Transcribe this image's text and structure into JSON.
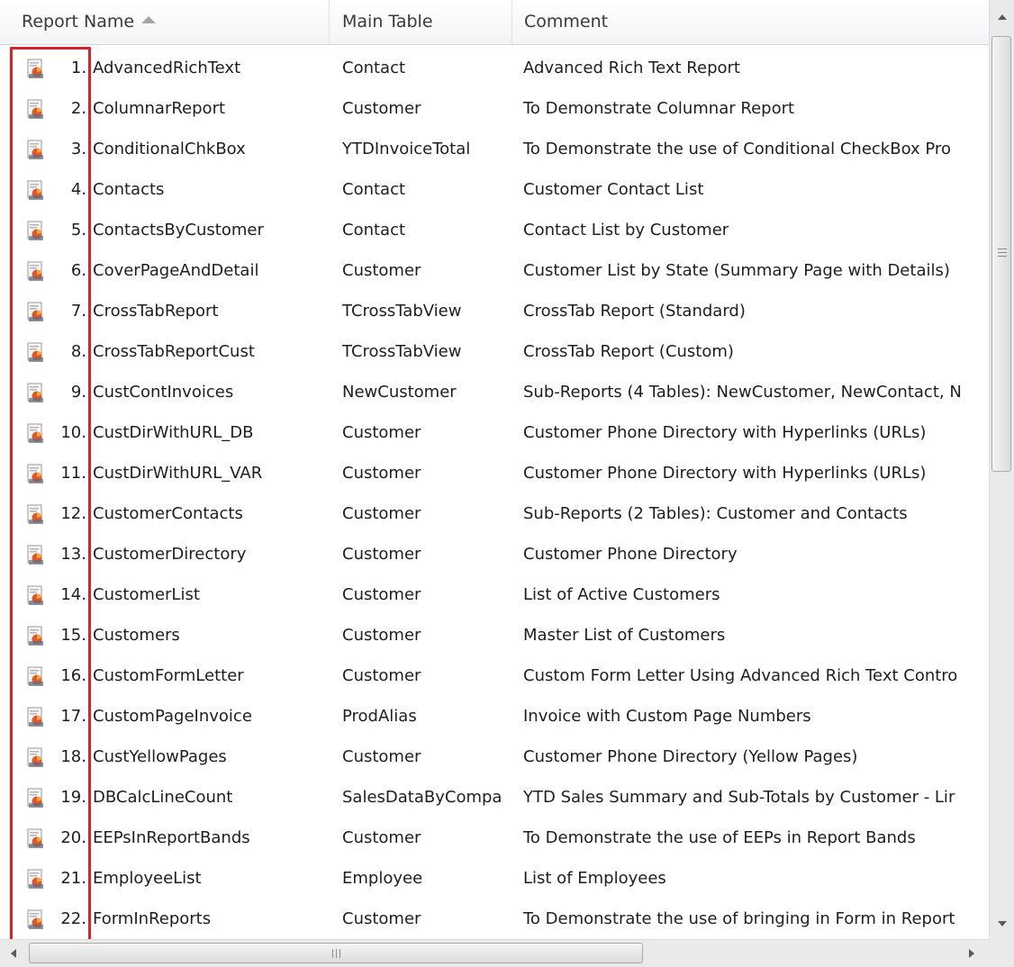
{
  "columns": {
    "name": "Report Name",
    "table": "Main Table",
    "comment": "Comment"
  },
  "sort": {
    "column": "Report Name",
    "direction": "ascending"
  },
  "highlight_color": "#d8232a",
  "rows": [
    {
      "num": "1.",
      "name": "AdvancedRichText",
      "table": "Contact",
      "comment": "Advanced Rich Text Report"
    },
    {
      "num": "2.",
      "name": "ColumnarReport",
      "table": "Customer",
      "comment": "To Demonstrate Columnar Report"
    },
    {
      "num": "3.",
      "name": "ConditionalChkBox",
      "table": "YTDInvoiceTotal",
      "comment": "To Demonstrate the use of Conditional CheckBox Pro"
    },
    {
      "num": "4.",
      "name": "Contacts",
      "table": "Contact",
      "comment": "Customer Contact List"
    },
    {
      "num": "5.",
      "name": "ContactsByCustomer",
      "table": "Contact",
      "comment": "Contact List by Customer"
    },
    {
      "num": "6.",
      "name": "CoverPageAndDetail",
      "table": "Customer",
      "comment": "Customer List by State (Summary Page with Details)"
    },
    {
      "num": "7.",
      "name": "CrossTabReport",
      "table": "TCrossTabView",
      "comment": "CrossTab Report (Standard)"
    },
    {
      "num": "8.",
      "name": "CrossTabReportCust",
      "table": "TCrossTabView",
      "comment": "CrossTab Report (Custom)"
    },
    {
      "num": "9.",
      "name": "CustContInvoices",
      "table": "NewCustomer",
      "comment": "Sub-Reports (4 Tables): NewCustomer, NewContact, N"
    },
    {
      "num": "10.",
      "name": "CustDirWithURL_DB",
      "table": "Customer",
      "comment": "Customer Phone Directory with Hyperlinks (URLs)"
    },
    {
      "num": "11.",
      "name": "CustDirWithURL_VAR",
      "table": "Customer",
      "comment": "Customer Phone Directory with Hyperlinks (URLs)"
    },
    {
      "num": "12.",
      "name": "CustomerContacts",
      "table": "Customer",
      "comment": "Sub-Reports (2 Tables): Customer and Contacts"
    },
    {
      "num": "13.",
      "name": "CustomerDirectory",
      "table": "Customer",
      "comment": "Customer Phone Directory"
    },
    {
      "num": "14.",
      "name": "CustomerList",
      "table": "Customer",
      "comment": "List of Active Customers"
    },
    {
      "num": "15.",
      "name": "Customers",
      "table": "Customer",
      "comment": "Master List of Customers"
    },
    {
      "num": "16.",
      "name": "CustomFormLetter",
      "table": "Customer",
      "comment": "Custom Form Letter Using Advanced Rich Text Contro"
    },
    {
      "num": "17.",
      "name": "CustomPageInvoice",
      "table": "ProdAlias",
      "comment": "Invoice with Custom Page Numbers"
    },
    {
      "num": "18.",
      "name": "CustYellowPages",
      "table": "Customer",
      "comment": "Customer Phone Directory (Yellow Pages)"
    },
    {
      "num": "19.",
      "name": "DBCalcLineCount",
      "table": "SalesDataByCompa",
      "comment": "YTD Sales Summary and Sub-Totals by Customer - Lir"
    },
    {
      "num": "20.",
      "name": "EEPsInReportBands",
      "table": "Customer",
      "comment": "To Demonstrate the use of EEPs in Report Bands"
    },
    {
      "num": "21.",
      "name": "EmployeeList",
      "table": "Employee",
      "comment": "List of Employees"
    },
    {
      "num": "22.",
      "name": "FormInReports",
      "table": "Customer",
      "comment": "To Demonstrate the use of bringing in Form in Report"
    }
  ],
  "row_icon": "report-document-icon",
  "scrollbars": {
    "vertical_icons": [
      "arrow-up-icon",
      "arrow-down-icon"
    ],
    "horizontal_icons": [
      "arrow-left-icon",
      "arrow-right-icon"
    ]
  }
}
